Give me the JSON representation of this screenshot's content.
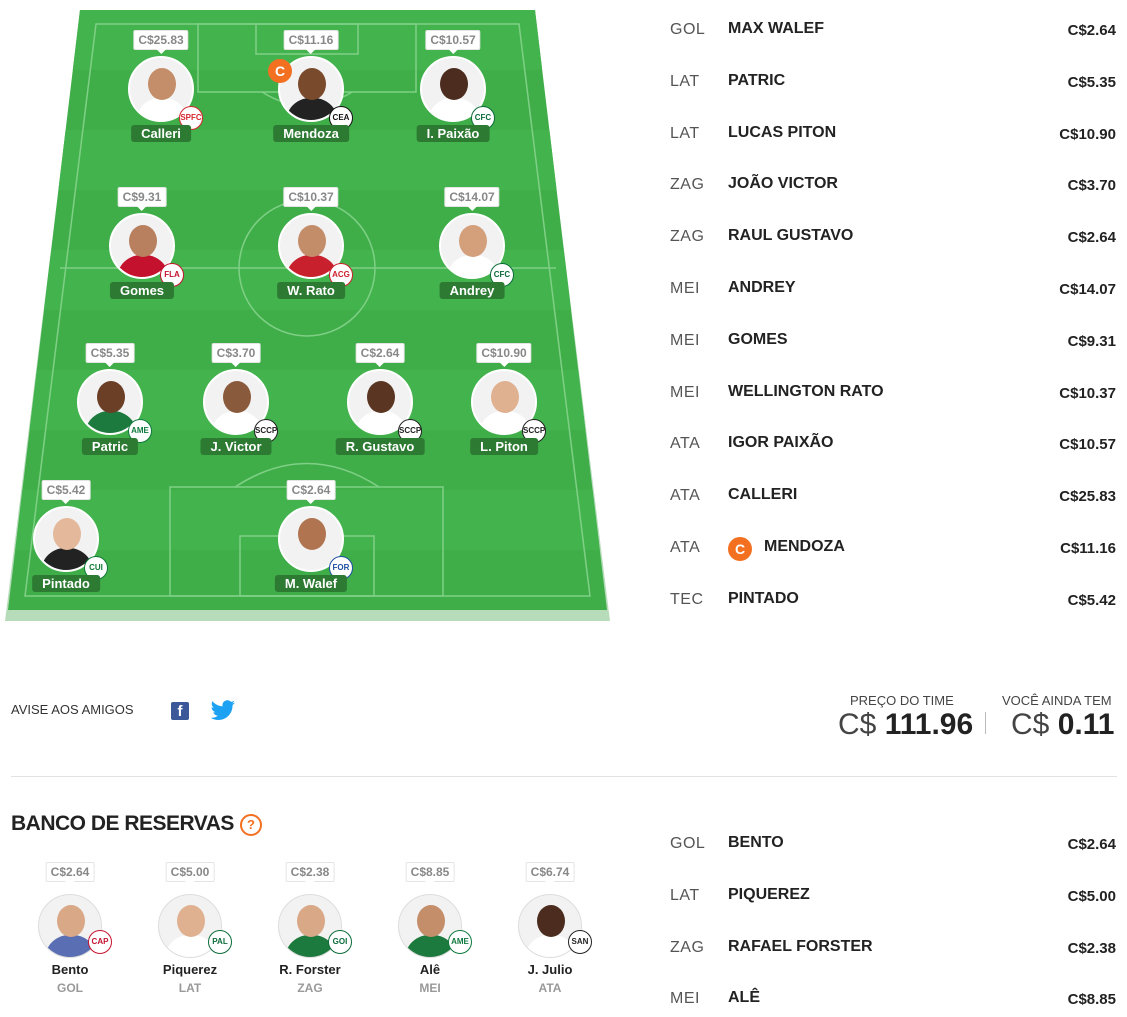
{
  "colors": {
    "field_green": "#3fae49",
    "field_dark": "#35a03f",
    "name_tag": "#2d7a33",
    "captain": "#f37021",
    "facebook": "#3b5998",
    "twitter": "#1da1f2"
  },
  "field_players": [
    {
      "name": "Calleri",
      "price": "C$25.83",
      "club": "SPFC",
      "club_color": "#d6262e",
      "shirt": "#ffffff",
      "skin": "#c58e6b",
      "captain": false
    },
    {
      "name": "Mendoza",
      "price": "C$11.16",
      "club": "CEA",
      "club_color": "#111111",
      "shirt": "#222222",
      "skin": "#7a4a2d",
      "captain": true,
      "captain_label": "C"
    },
    {
      "name": "I. Paixão",
      "price": "C$10.57",
      "club": "CFC",
      "club_color": "#0b6b3a",
      "shirt": "#ffffff",
      "skin": "#4b2c1e",
      "captain": false
    },
    {
      "name": "Gomes",
      "price": "C$9.31",
      "club": "FLA",
      "club_color": "#c4122e",
      "shirt": "#c4122e",
      "skin": "#b8805e",
      "captain": false
    },
    {
      "name": "W. Rato",
      "price": "C$10.37",
      "club": "ACG",
      "club_color": "#cc1f2d",
      "shirt": "#c8202c",
      "skin": "#c38d6a",
      "captain": false
    },
    {
      "name": "Andrey",
      "price": "C$14.07",
      "club": "CFC",
      "club_color": "#0b6b3a",
      "shirt": "#ffffff",
      "skin": "#d4a07c",
      "captain": false
    },
    {
      "name": "Patric",
      "price": "C$5.35",
      "club": "AME",
      "club_color": "#0f7a3e",
      "shirt": "#1d7a3e",
      "skin": "#6b3e26",
      "captain": false
    },
    {
      "name": "J. Victor",
      "price": "C$3.70",
      "club": "SCCP",
      "club_color": "#222222",
      "shirt": "#ffffff",
      "skin": "#8a5a3c",
      "captain": false
    },
    {
      "name": "R. Gustavo",
      "price": "C$2.64",
      "club": "SCCP",
      "club_color": "#222222",
      "shirt": "#ffffff",
      "skin": "#5a3522",
      "captain": false
    },
    {
      "name": "L. Piton",
      "price": "C$10.90",
      "club": "SCCP",
      "club_color": "#222222",
      "shirt": "#ffffff",
      "skin": "#e0b191",
      "captain": false
    },
    {
      "name": "Pintado",
      "price": "C$5.42",
      "club": "CUI",
      "club_color": "#0c7a35",
      "shirt": "#222222",
      "skin": "#e4b89a",
      "captain": false
    },
    {
      "name": "M. Walef",
      "price": "C$2.64",
      "club": "FOR",
      "club_color": "#1b4fa0",
      "shirt": "#f2f2f2",
      "skin": "#b07550",
      "captain": false
    }
  ],
  "lineup": [
    {
      "pos": "GOL",
      "name": "MAX WALEF",
      "price": "C$2.64"
    },
    {
      "pos": "LAT",
      "name": "PATRIC",
      "price": "C$5.35"
    },
    {
      "pos": "LAT",
      "name": "LUCAS PITON",
      "price": "C$10.90"
    },
    {
      "pos": "ZAG",
      "name": "JOÃO VICTOR",
      "price": "C$3.70"
    },
    {
      "pos": "ZAG",
      "name": "RAUL GUSTAVO",
      "price": "C$2.64"
    },
    {
      "pos": "MEI",
      "name": "ANDREY",
      "price": "C$14.07"
    },
    {
      "pos": "MEI",
      "name": "GOMES",
      "price": "C$9.31"
    },
    {
      "pos": "MEI",
      "name": "WELLINGTON RATO",
      "price": "C$10.37"
    },
    {
      "pos": "ATA",
      "name": "IGOR PAIXÃO",
      "price": "C$10.57"
    },
    {
      "pos": "ATA",
      "name": "CALLERI",
      "price": "C$25.83"
    },
    {
      "pos": "ATA",
      "name": "MENDOZA",
      "price": "C$11.16",
      "captain": true,
      "captain_label": "C"
    },
    {
      "pos": "TEC",
      "name": "PINTADO",
      "price": "C$5.42"
    }
  ],
  "share": {
    "label": "AVISE AOS AMIGOS",
    "facebook_icon": "facebook-icon",
    "twitter_icon": "twitter-icon"
  },
  "team_price": {
    "label": "PREÇO DO TIME",
    "currency": "C$",
    "value": "111.96"
  },
  "remaining": {
    "label": "VOCÊ AINDA TEM",
    "currency": "C$",
    "value": "0.11"
  },
  "bench": {
    "title": "BANCO DE RESERVAS",
    "help_label": "?",
    "players": [
      {
        "name": "Bento",
        "pos": "GOL",
        "price": "C$2.64",
        "club": "CAP",
        "club_color": "#c4122e",
        "shirt": "#5a6fb3",
        "skin": "#d9a887"
      },
      {
        "name": "Piquerez",
        "pos": "LAT",
        "price": "C$5.00",
        "club": "PAL",
        "club_color": "#0b6b3a",
        "shirt": "#ffffff",
        "skin": "#e0b191"
      },
      {
        "name": "R. Forster",
        "pos": "ZAG",
        "price": "C$2.38",
        "club": "GOI",
        "club_color": "#0b6b3a",
        "shirt": "#1d7a3e",
        "skin": "#d9a887"
      },
      {
        "name": "Alê",
        "pos": "MEI",
        "price": "C$8.85",
        "club": "AME",
        "club_color": "#0f7a3e",
        "shirt": "#1d7a3e",
        "skin": "#c58e6b"
      },
      {
        "name": "J. Julio",
        "pos": "ATA",
        "price": "C$6.74",
        "club": "SAN",
        "club_color": "#222222",
        "shirt": "#ffffff",
        "skin": "#4b2c1e"
      }
    ],
    "list": [
      {
        "pos": "GOL",
        "name": "BENTO",
        "price": "C$2.64"
      },
      {
        "pos": "LAT",
        "name": "PIQUEREZ",
        "price": "C$5.00"
      },
      {
        "pos": "ZAG",
        "name": "RAFAEL FORSTER",
        "price": "C$2.38"
      },
      {
        "pos": "MEI",
        "name": "ALÊ",
        "price": "C$8.85"
      }
    ]
  }
}
